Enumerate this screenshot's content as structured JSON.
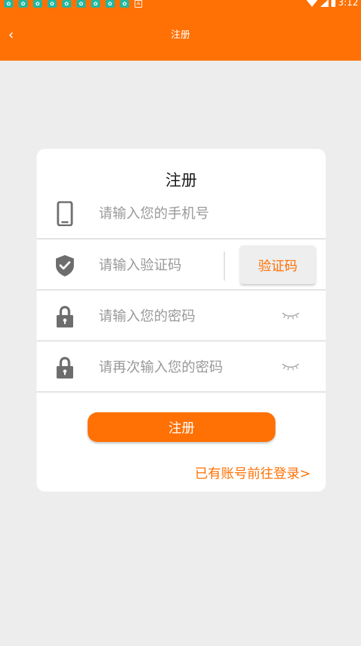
{
  "status_bar": {
    "time": "3:12"
  },
  "nav": {
    "back_icon": "chevron-left-icon",
    "title": "注册"
  },
  "form": {
    "title": "注册",
    "phone": {
      "placeholder": "请输入您的手机号",
      "icon": "phone-icon"
    },
    "code": {
      "placeholder": "请输入验证码",
      "icon": "shield-check-icon",
      "button_label": "验证码"
    },
    "password": {
      "placeholder": "请输入您的密码",
      "icon": "lock-icon",
      "toggle_icon": "eye-closed-icon"
    },
    "confirm_password": {
      "placeholder": "请再次输入您的密码",
      "icon": "lock-icon",
      "toggle_icon": "eye-closed-icon"
    },
    "submit_label": "注册",
    "login_link": "已有账号前往登录>"
  },
  "colors": {
    "accent": "#ff7104",
    "background": "#ededed",
    "card": "#ffffff",
    "icon": "#6d6d6d"
  }
}
